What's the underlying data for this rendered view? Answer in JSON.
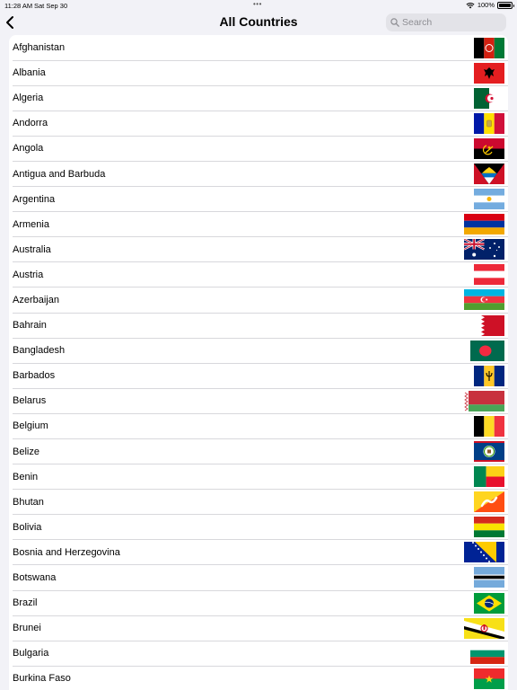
{
  "status_bar": {
    "time": "11:28 AM",
    "date": "Sat Sep 30",
    "battery": "100%"
  },
  "nav": {
    "title": "All Countries",
    "search_placeholder": "Search"
  },
  "countries": [
    {
      "name": "Afghanistan",
      "flag": "afghanistan-flag"
    },
    {
      "name": "Albania",
      "flag": "albania-flag"
    },
    {
      "name": "Algeria",
      "flag": "algeria-flag"
    },
    {
      "name": "Andorra",
      "flag": "andorra-flag"
    },
    {
      "name": "Angola",
      "flag": "angola-flag"
    },
    {
      "name": "Antigua and Barbuda",
      "flag": "antigua-and-barbuda-flag"
    },
    {
      "name": "Argentina",
      "flag": "argentina-flag"
    },
    {
      "name": "Armenia",
      "flag": "armenia-flag"
    },
    {
      "name": "Australia",
      "flag": "australia-flag"
    },
    {
      "name": "Austria",
      "flag": "austria-flag"
    },
    {
      "name": "Azerbaijan",
      "flag": "azerbaijan-flag"
    },
    {
      "name": "Bahrain",
      "flag": "bahrain-flag"
    },
    {
      "name": "Bangladesh",
      "flag": "bangladesh-flag"
    },
    {
      "name": "Barbados",
      "flag": "barbados-flag"
    },
    {
      "name": "Belarus",
      "flag": "belarus-flag"
    },
    {
      "name": "Belgium",
      "flag": "belgium-flag"
    },
    {
      "name": "Belize",
      "flag": "belize-flag"
    },
    {
      "name": "Benin",
      "flag": "benin-flag"
    },
    {
      "name": "Bhutan",
      "flag": "bhutan-flag"
    },
    {
      "name": "Bolivia",
      "flag": "bolivia-flag"
    },
    {
      "name": "Bosnia and Herzegovina",
      "flag": "bosnia-flag"
    },
    {
      "name": "Botswana",
      "flag": "botswana-flag"
    },
    {
      "name": "Brazil",
      "flag": "brazil-flag"
    },
    {
      "name": "Brunei",
      "flag": "brunei-flag"
    },
    {
      "name": "Bulgaria",
      "flag": "bulgaria-flag"
    },
    {
      "name": "Burkina Faso",
      "flag": "burkina-faso-flag"
    }
  ]
}
